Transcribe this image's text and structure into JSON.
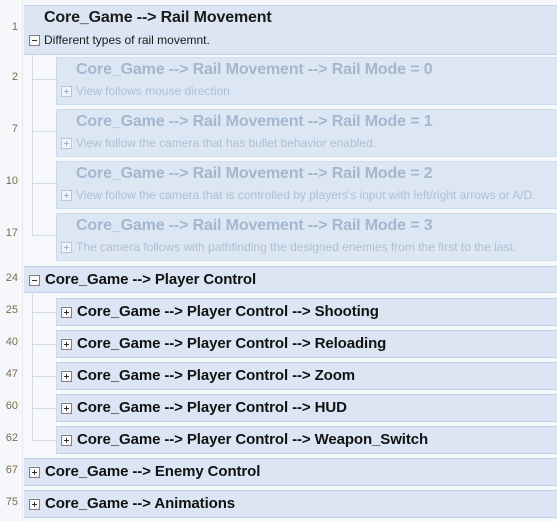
{
  "editor": {
    "kind": "code-folding-outline",
    "colors": {
      "page_background": "#f7f8fb",
      "gutter_background": "#f6f7fa",
      "row_active": "#dbe5f3",
      "row_dimmed": "#dde7f4",
      "row_border": "#c3d4ea",
      "text_active": "#1a1a1a",
      "text_dimmed": "#a3b7cf",
      "linenumber": "#7b6a4e"
    }
  },
  "blocks": [
    {
      "lineno": "1",
      "level": 0,
      "dimmed": false,
      "fold_state": "expanded",
      "fold_icon": "minus-box-icon",
      "title": "Core_Game --> Rail Movement",
      "description": "Different types of rail movemnt."
    },
    {
      "lineno": "2",
      "level": 1,
      "dimmed": true,
      "fold_state": "collapsed",
      "fold_icon": "plus-box-icon",
      "title": "Core_Game --> Rail Movement --> Rail Mode = 0",
      "description": "View follows mouse direction"
    },
    {
      "lineno": "7",
      "level": 1,
      "dimmed": true,
      "fold_state": "collapsed",
      "fold_icon": "plus-box-icon",
      "title": "Core_Game --> Rail Movement --> Rail Mode = 1",
      "description": "View follow the camera that has bullet behavior enabled."
    },
    {
      "lineno": "10",
      "level": 1,
      "dimmed": true,
      "fold_state": "collapsed",
      "fold_icon": "plus-box-icon",
      "title": "Core_Game --> Rail Movement --> Rail Mode = 2",
      "description": "View follow the camera that is controlled by players's input with left/right arrows or A/D."
    },
    {
      "lineno": "17",
      "level": 1,
      "dimmed": true,
      "fold_state": "collapsed",
      "fold_icon": "plus-box-icon",
      "title": "Core_Game --> Rail Movement --> Rail Mode = 3",
      "description": "The camera follows with pathfinding the designed enemies from the first to the last."
    },
    {
      "lineno": "24",
      "level": 0,
      "dimmed": false,
      "fold_state": "expanded",
      "fold_icon": "minus-box-icon",
      "title": "Core_Game --> Player Control",
      "description": ""
    },
    {
      "lineno": "25",
      "level": 1,
      "dimmed": false,
      "fold_state": "collapsed",
      "fold_icon": "plus-box-icon",
      "title": "Core_Game --> Player Control --> Shooting",
      "description": ""
    },
    {
      "lineno": "40",
      "level": 1,
      "dimmed": false,
      "fold_state": "collapsed",
      "fold_icon": "plus-box-icon",
      "title": "Core_Game --> Player Control --> Reloading",
      "description": ""
    },
    {
      "lineno": "47",
      "level": 1,
      "dimmed": false,
      "fold_state": "collapsed",
      "fold_icon": "plus-box-icon",
      "title": "Core_Game --> Player Control --> Zoom",
      "description": ""
    },
    {
      "lineno": "60",
      "level": 1,
      "dimmed": false,
      "fold_state": "collapsed",
      "fold_icon": "plus-box-icon",
      "title": "Core_Game --> Player Control --> HUD",
      "description": ""
    },
    {
      "lineno": "62",
      "level": 1,
      "dimmed": false,
      "fold_state": "collapsed",
      "fold_icon": "plus-box-icon",
      "title": "Core_Game --> Player Control --> Weapon_Switch",
      "description": ""
    },
    {
      "lineno": "67",
      "level": 0,
      "dimmed": false,
      "fold_state": "collapsed",
      "fold_icon": "plus-box-icon",
      "title": "Core_Game --> Enemy Control",
      "description": ""
    },
    {
      "lineno": "75",
      "level": 0,
      "dimmed": false,
      "fold_state": "collapsed",
      "fold_icon": "plus-box-icon",
      "title": "Core_Game --> Animations",
      "description": ""
    }
  ]
}
